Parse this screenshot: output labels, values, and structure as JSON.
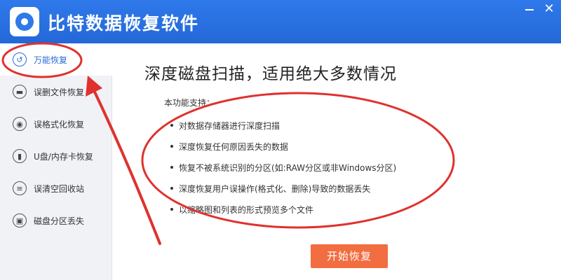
{
  "app": {
    "title": "比特数据恢复软件"
  },
  "window": {
    "minimize_icon": "minimize-icon",
    "close_label": "✕"
  },
  "sidebar": {
    "items": [
      {
        "label": "万能恢复",
        "icon": "restore-icon"
      },
      {
        "label": "误删文件恢复",
        "icon": "folder-icon"
      },
      {
        "label": "误格式化恢复",
        "icon": "format-icon"
      },
      {
        "label": "U盘/内存卡恢复",
        "icon": "usb-icon"
      },
      {
        "label": "误清空回收站",
        "icon": "trash-icon"
      },
      {
        "label": "磁盘分区丢失",
        "icon": "disk-icon"
      }
    ]
  },
  "main": {
    "headline": "深度磁盘扫描，适用绝大多数情况",
    "support_label": "本功能支持：",
    "features": [
      "对数据存储器进行深度扫描",
      "深度恢复任何原因丢失的数据",
      "恢复不被系统识别的分区(如:RAW分区或非Windows分区)",
      "深度恢复用户误操作(格式化、删除)导致的数据丢失",
      "以缩略图和列表的形式预览多个文件"
    ],
    "start_button": "开始恢复"
  },
  "annotation": {
    "color": "#e0312d"
  }
}
